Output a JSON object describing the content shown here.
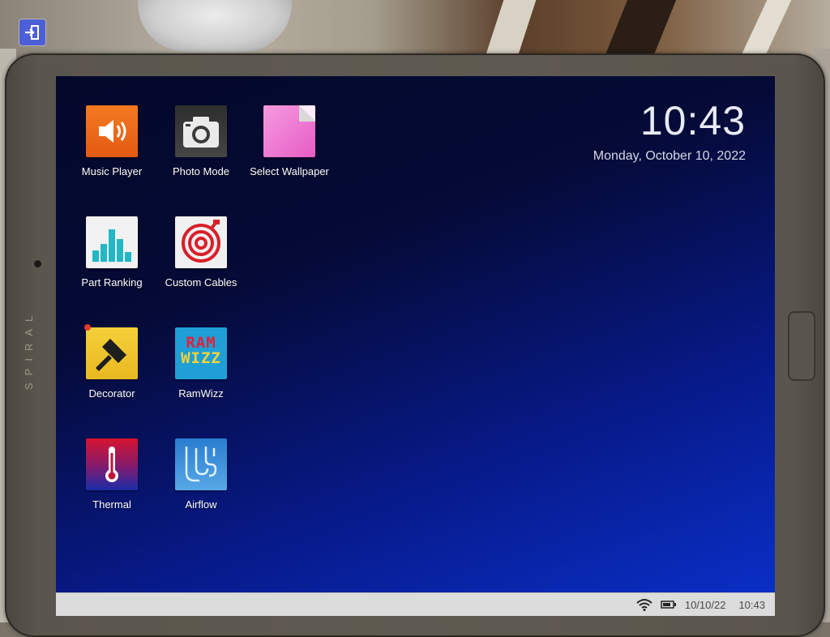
{
  "background": {
    "exit_icon": "exit-icon"
  },
  "tablet": {
    "brand": "SPIRAL"
  },
  "clock": {
    "time": "10:43",
    "date": "Monday, October 10, 2022"
  },
  "apps": [
    {
      "label": "Music Player",
      "icon": "speaker-icon",
      "color": "#ef6a1c"
    },
    {
      "label": "Photo Mode",
      "icon": "camera-icon",
      "color": "#3a3a3a"
    },
    {
      "label": "Select Wallpaper",
      "icon": "wallpaper-icon",
      "color": "#f07ad0"
    },
    {
      "label": "Part Ranking",
      "icon": "bar-chart-icon",
      "color": "#f2f2f2"
    },
    {
      "label": "Custom Cables",
      "icon": "cable-icon",
      "color": "#f0f0f0"
    },
    {
      "label": "Decorator",
      "icon": "paintbrush-icon",
      "color": "#f2c830",
      "notification": true
    },
    {
      "label": "RamWizz",
      "icon": "ramwizz-icon",
      "color": "#1ea0d6",
      "logo_text": [
        "RAM",
        "WIZZ"
      ]
    },
    {
      "label": "Thermal",
      "icon": "thermometer-icon",
      "color": "#c0143a"
    },
    {
      "label": "Airflow",
      "icon": "airflow-icon",
      "color": "#3a8fd6"
    }
  ],
  "taskbar": {
    "wifi_icon": "wifi-icon",
    "battery_icon": "battery-icon",
    "date": "10/10/22",
    "time": "10:43"
  }
}
